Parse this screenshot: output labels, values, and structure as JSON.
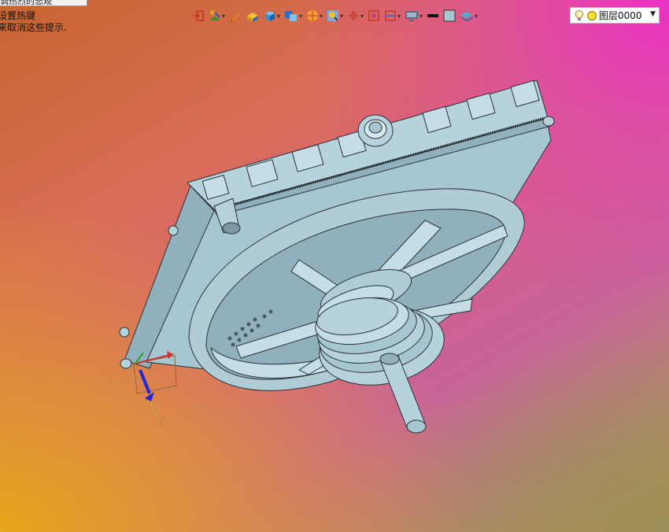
{
  "window": {
    "tab_title": "调热烈的悲观"
  },
  "hints": {
    "line1": "设置热键",
    "line2": "来取消这些提示."
  },
  "toolbar": {
    "tools": [
      {
        "icon": "exit-icon",
        "dropdown": false
      },
      {
        "icon": "sketch-icon",
        "dropdown": true
      },
      {
        "icon": "pencil-icon",
        "dropdown": false
      },
      {
        "icon": "extrude-icon",
        "dropdown": false
      },
      {
        "icon": "cube-icon",
        "dropdown": true
      },
      {
        "icon": "boolean-icon",
        "dropdown": true
      },
      {
        "icon": "render-sphere-icon",
        "dropdown": true
      },
      {
        "icon": "zoom-icon",
        "dropdown": true
      },
      {
        "icon": "axis-icon",
        "dropdown": true
      },
      {
        "icon": "fit-view-icon",
        "dropdown": false
      },
      {
        "icon": "section-icon",
        "dropdown": true
      },
      {
        "icon": "monitor-icon",
        "dropdown": true
      },
      {
        "icon": "line-color-icon",
        "dropdown": false
      },
      {
        "icon": "face-color-icon",
        "dropdown": false
      },
      {
        "icon": "layer-display-icon",
        "dropdown": true
      }
    ],
    "layer": {
      "name": "图层0000",
      "bulb_icon": "bulb-icon",
      "status_icon": "layer-status-icon"
    }
  },
  "axis": {
    "label": "Z"
  },
  "colors": {
    "model_fill": "#a6c6d2",
    "model_edge": "#2a3236",
    "axis_z": "#2424d8",
    "axis_x": "#d43030",
    "axis_y": "#2ca02c"
  }
}
